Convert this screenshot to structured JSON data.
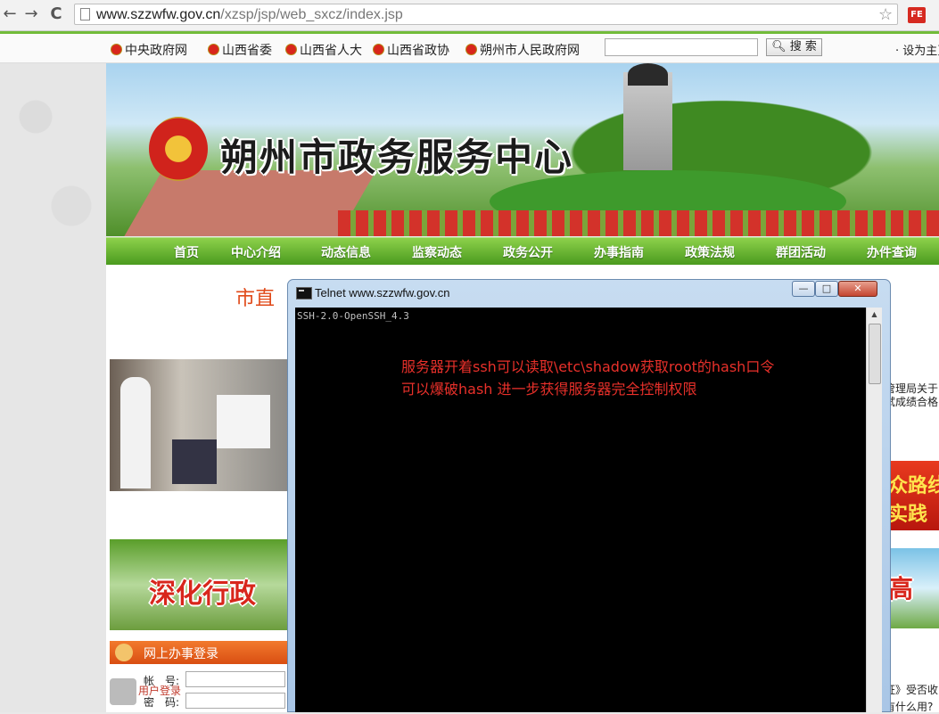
{
  "browser": {
    "back": "←",
    "forward": "→",
    "reload": "C",
    "url_host": "www.szzwfw.gov.cn",
    "url_path": "/xzsp/jsp/web_sxcz/index.jsp",
    "bookmark": "☆",
    "extension_label": "FE"
  },
  "topbar": {
    "links": [
      "中央政府网",
      "山西省委",
      "山西省人大",
      "山西省政协",
      "朔州市人民政府网"
    ],
    "search_button": "搜 索",
    "set_home": "· 设为主页"
  },
  "banner": {
    "title": "朔州市政务服务中心"
  },
  "menu": {
    "items": [
      "首页",
      "中心介绍",
      "动态信息",
      "监察动态",
      "政务公开",
      "办事指南",
      "政策法规",
      "群团活动",
      "办件查询"
    ]
  },
  "content": {
    "headline": "市直",
    "banner2_text": "深化行政",
    "login": {
      "title": "网上办事登录",
      "account_label": "帐　号:",
      "password_label": "密　码:",
      "user_label": "用户登录"
    },
    "right": {
      "line1": "管理局关于",
      "line2": "试成绩合格",
      "banner1_line1": "众路线",
      "banner1_line2": "实践",
      "banner2_text": "高",
      "bottom1": "证》受否收",
      "bottom2": "有什么用?"
    }
  },
  "telnet": {
    "title": "Telnet www.szzwfw.gov.cn",
    "minimize": "—",
    "maximize": "□",
    "close": "✕",
    "banner_line": "SSH-2.0-OpenSSH_4.3",
    "note_line1": "服务器开着ssh可以读取\\etc\\shadow获取root的hash口令",
    "note_line2": "可以爆破hash 进一步获得服务器完全控制权限"
  }
}
